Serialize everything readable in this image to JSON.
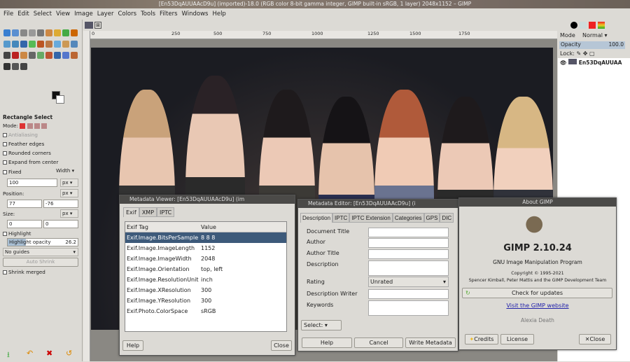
{
  "window": {
    "title": "[En53DqAUUAAcD9u] (imported)-18.0 (RGB color 8-bit gamma integer, GIMP built-in sRGB, 1 layer) 2048x1152 – GIMP"
  },
  "menu": [
    "File",
    "Edit",
    "Select",
    "View",
    "Image",
    "Layer",
    "Colors",
    "Tools",
    "Filters",
    "Windows",
    "Help"
  ],
  "tool_options": {
    "title": "Rectangle Select",
    "mode_label": "Mode:",
    "antialiasing": "Antialiasing",
    "feather": "Feather edges",
    "rounded": "Rounded corners",
    "expand": "Expand from center",
    "fixed": "Fixed",
    "fixed_mode": "Width",
    "fixed_value": "100",
    "unit": "px",
    "position_label": "Position:",
    "pos_x": "77",
    "pos_y": "-76",
    "size_label": "Size:",
    "size_w": "0",
    "size_h": "0",
    "highlight": "Highlight",
    "highlight_opacity_label": "Highlight opacity",
    "highlight_opacity": "26.2",
    "guides": "No guides",
    "auto_shrink": "Auto Shrink",
    "shrink_merged": "Shrink merged"
  },
  "ruler": {
    "ticks": [
      "0",
      "250",
      "500",
      "750",
      "1000",
      "1250",
      "1500",
      "1750"
    ]
  },
  "layers": {
    "mode_label": "Mode",
    "mode": "Normal",
    "opacity_label": "Opacity",
    "opacity": "100.0",
    "lock_label": "Lock:",
    "layer_name": "En53DqAUUAA"
  },
  "metadata_viewer": {
    "title": "Metadata Viewer: [En53DqAUUAAcD9u] (im",
    "tabs": [
      "Exif",
      "XMP",
      "IPTC"
    ],
    "columns": [
      "Exif Tag",
      "Value"
    ],
    "rows": [
      [
        "Exif.Image.BitsPerSample",
        "8 8 8"
      ],
      [
        "Exif.Image.ImageLength",
        "1152"
      ],
      [
        "Exif.Image.ImageWidth",
        "2048"
      ],
      [
        "Exif.Image.Orientation",
        "top, left"
      ],
      [
        "Exif.Image.ResolutionUnit",
        "inch"
      ],
      [
        "Exif.Image.XResolution",
        "300"
      ],
      [
        "Exif.Image.YResolution",
        "300"
      ],
      [
        "Exif.Photo.ColorSpace",
        "sRGB"
      ]
    ],
    "help": "Help",
    "close": "Close"
  },
  "metadata_editor": {
    "title": "Metadata Editor: [En53DqAUUAAcD9u] (i",
    "tabs": [
      "Description",
      "IPTC",
      "IPTC Extension",
      "Categories",
      "GPS",
      "DIC"
    ],
    "fields": [
      "Document Title",
      "Author",
      "Author Title",
      "Description",
      "Rating",
      "Description Writer",
      "Keywords"
    ],
    "rating": "Unrated",
    "select": "Select:",
    "help": "Help",
    "cancel": "Cancel",
    "write": "Write Metadata"
  },
  "about": {
    "title": "About GIMP",
    "version": "GIMP 2.10.24",
    "subtitle": "GNU Image Manipulation Program",
    "copyright": "Copyright © 1995-2021",
    "authors": "Spencer Kimball, Peter Mattis and the GIMP Development Team",
    "check_updates": "Check for updates",
    "website": "Visit the GIMP website",
    "author_anim": "Alexia Death",
    "credits": "Credits",
    "license": "License",
    "close": "Close"
  }
}
